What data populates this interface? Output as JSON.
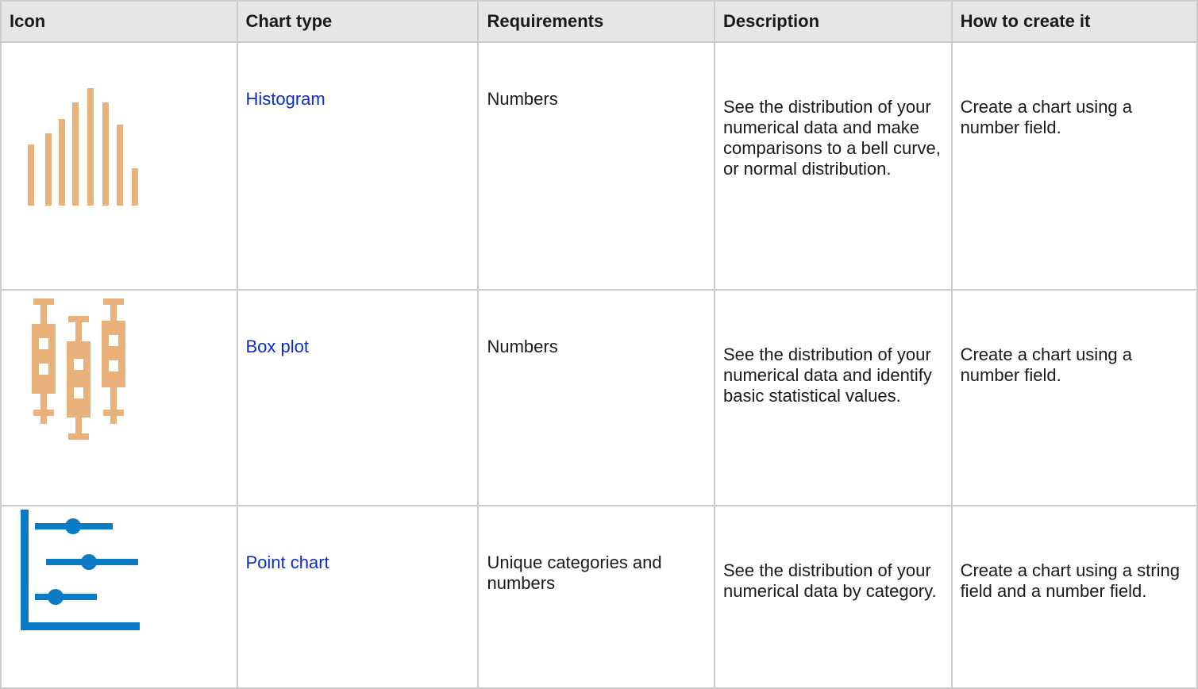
{
  "headers": {
    "icon": "Icon",
    "chart_type": "Chart type",
    "requirements": "Requirements",
    "description": "Description",
    "how_to": "How to create it"
  },
  "rows": [
    {
      "icon": "histogram-icon",
      "chart_type": "Histogram",
      "requirements": "Numbers",
      "description": "See the distribution of your numerical data and make comparisons to a bell curve, or normal distribution.",
      "how_to": "Create a chart using a number field."
    },
    {
      "icon": "box-plot-icon",
      "chart_type": "Box plot",
      "requirements": "Numbers",
      "description": "See the distribution of your numerical data and identify basic statistical values.",
      "how_to": "Create a chart using a number field."
    },
    {
      "icon": "point-chart-icon",
      "chart_type": "Point chart",
      "requirements": "Unique categories and numbers",
      "description": "See the distribution of your numerical data by category.",
      "how_to": "Create a chart using a string field and a number field."
    }
  ],
  "colors": {
    "header_bg": "#e6e6e6",
    "border": "#cccccc",
    "link": "#0a2ecc",
    "orange_icon": "#e8b27a",
    "blue_icon": "#0a7bc4"
  }
}
